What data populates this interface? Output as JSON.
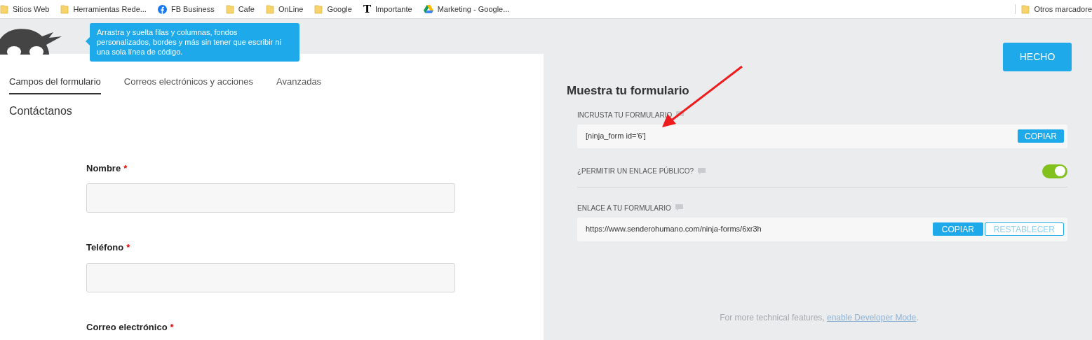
{
  "bookmarks": [
    {
      "kind": "folder",
      "label": "Sitios Web"
    },
    {
      "kind": "folder",
      "label": "Herramientas Rede..."
    },
    {
      "kind": "facebook",
      "label": "FB Business"
    },
    {
      "kind": "folder",
      "label": "Cafe"
    },
    {
      "kind": "folder",
      "label": "OnLine"
    },
    {
      "kind": "folder",
      "label": "Google"
    },
    {
      "kind": "letter",
      "glyph": "T",
      "label": "Importante"
    },
    {
      "kind": "drive",
      "label": "Marketing - Google..."
    }
  ],
  "other_bookmarks": "Otros marcadore",
  "tooltip": "Arrastra y suelta filas y columnas, fondos personalizados, bordes y más sin tener que escribir ni una sola línea de código.",
  "tabs": [
    {
      "label": "Campos del formulario",
      "selected": true
    },
    {
      "label": "Correos electrónicos y acciones",
      "selected": false
    },
    {
      "label": "Avanzadas",
      "selected": false
    }
  ],
  "form_title": "Contáctanos",
  "fields": [
    {
      "label": "Nombre",
      "required": true
    },
    {
      "label": "Teléfono",
      "required": true
    },
    {
      "label": "Correo electrónico",
      "required": true
    }
  ],
  "required_mark": "*",
  "done_button": "HECHO",
  "publish": {
    "title": "Muestra tu formulario",
    "embed_label": "INCRUSTA TU FORMULARIO",
    "shortcode": "[ninja_form id='6']",
    "copy_button": "COPIAR",
    "public_link_label": "¿PERMITIR UN ENLACE PÚBLICO?",
    "public_link_on": true,
    "link_label": "ENLACE A TU FORMULARIO",
    "link": "https://www.senderohumano.com/ninja-forms/6xr3h",
    "link_copy_button": "COPIAR",
    "reset_button": "RESTABLECER"
  },
  "footer": {
    "text": "For more technical features, ",
    "link": "enable Developer Mode",
    "end": "."
  }
}
